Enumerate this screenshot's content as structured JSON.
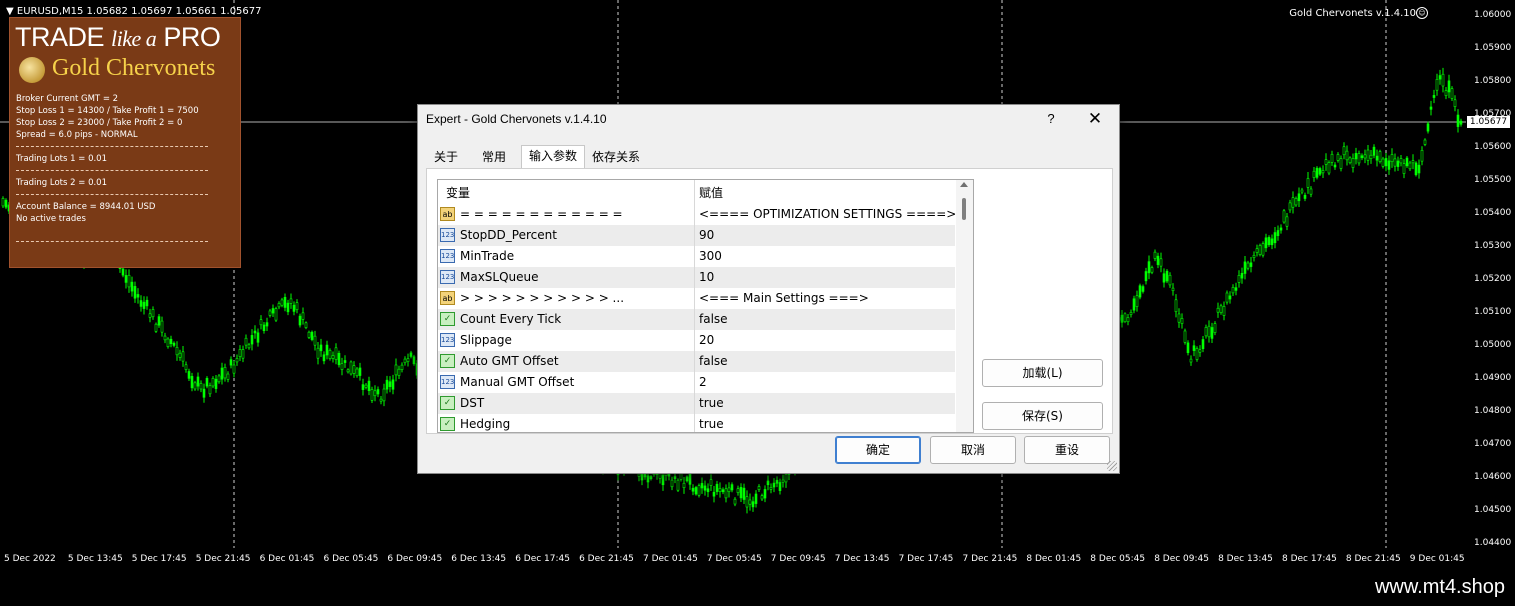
{
  "chart": {
    "symbol_info": "EURUSD,M15  1.05682 1.05697 1.05661 1.05677",
    "ea_name": "Gold Chervonets v.1.4.10",
    "current_price": "1.05677",
    "price_ticks": [
      "1.06000",
      "1.05900",
      "1.05800",
      "1.05700",
      "1.05600",
      "1.05500",
      "1.05400",
      "1.05300",
      "1.05200",
      "1.05100",
      "1.05000",
      "1.04900",
      "1.04800",
      "1.04700",
      "1.04600",
      "1.04500",
      "1.04400"
    ],
    "time_ticks": [
      "5 Dec 2022",
      "5 Dec 13:45",
      "5 Dec 17:45",
      "5 Dec 21:45",
      "6 Dec 01:45",
      "6 Dec 05:45",
      "6 Dec 09:45",
      "6 Dec 13:45",
      "6 Dec 17:45",
      "6 Dec 21:45",
      "7 Dec 01:45",
      "7 Dec 05:45",
      "7 Dec 09:45",
      "7 Dec 13:45",
      "7 Dec 17:45",
      "7 Dec 21:45",
      "8 Dec 01:45",
      "8 Dec 05:45",
      "8 Dec 09:45",
      "8 Dec 13:45",
      "8 Dec 17:45",
      "8 Dec 21:45",
      "9 Dec 01:45"
    ],
    "candle_color": "#00ff00",
    "background": "#000000"
  },
  "info_panel": {
    "brand_trade": "TRADE",
    "brand_like": "like a",
    "brand_pro": "PRO",
    "brand_name": "Gold Chervonets",
    "lines": [
      "Broker Current GMT = 2",
      "Stop Loss 1 = 14300 / Take Profit 1 = 7500",
      "Stop Loss 2 = 23000 / Take Profit 2 = 0",
      "Spread = 6.0 pips - NORMAL",
      "Trading Lots 1 = 0.01",
      "Trading Lots 2 = 0.01",
      "Account Balance = 8944.01 USD",
      "No active trades"
    ],
    "background": "#7a3a16"
  },
  "dialog": {
    "title": "Expert - Gold Chervonets v.1.4.10",
    "help": "?",
    "close": "✕",
    "tabs": [
      "关于",
      "常用",
      "输入参数",
      "依存关系"
    ],
    "active_tab": "输入参数",
    "columns": [
      "变量",
      "赋值"
    ],
    "rows": [
      {
        "type": "ab",
        "icon": "ab",
        "name": "= = = = = = = = = = = =",
        "value": "<==== OPTIMIZATION SETTINGS ====>"
      },
      {
        "type": "num",
        "icon": "123",
        "name": "StopDD_Percent",
        "value": "90"
      },
      {
        "type": "num",
        "icon": "123",
        "name": "MinTrade",
        "value": "300"
      },
      {
        "type": "num",
        "icon": "123",
        "name": "MaxSLQueue",
        "value": "10"
      },
      {
        "type": "ab",
        "icon": "ab",
        "name": ">  >  >  >  >  >  >  >  >  >  >  ...",
        "value": "<=== Main Settings ===>"
      },
      {
        "type": "bool",
        "icon": "✓",
        "name": "Count Every Tick",
        "value": "false"
      },
      {
        "type": "num",
        "icon": "123",
        "name": "Slippage",
        "value": "20"
      },
      {
        "type": "bool",
        "icon": "✓",
        "name": "Auto GMT Offset",
        "value": "false"
      },
      {
        "type": "num",
        "icon": "123",
        "name": "Manual GMT Offset",
        "value": "2"
      },
      {
        "type": "bool",
        "icon": "✓",
        "name": "DST",
        "value": "true"
      },
      {
        "type": "bool",
        "icon": "✓",
        "name": "Hedging",
        "value": "true"
      }
    ],
    "load_button": "加载(L)",
    "save_button": "保存(S)",
    "ok_button": "确定",
    "cancel_button": "取消",
    "reset_button": "重设"
  },
  "footer": {
    "url": "www.mt4.shop"
  }
}
